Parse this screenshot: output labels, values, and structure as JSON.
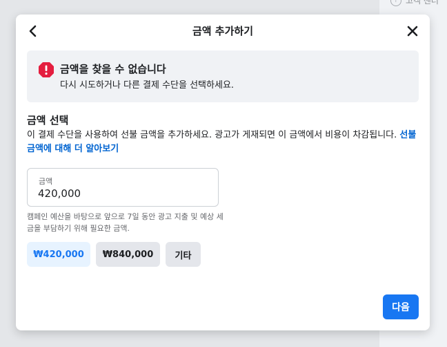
{
  "backdrop": {
    "corner_text": "고객 센터"
  },
  "dialog": {
    "title": "금액 추가하기",
    "error": {
      "title": "금액을 찾을 수 없습니다",
      "description": "다시 시도하거나 다른 결제 수단을 선택하세요."
    },
    "section": {
      "title": "금액 선택",
      "description": "이 결제 수단을 사용하여 선불 금액을 추가하세요. 광고가 게재되면 이 금액에서 비용이 차감됩니다.",
      "learn_more": "선불 금액에 대해 더 알아보기"
    },
    "amount_field": {
      "label": "금액",
      "value": "420,000"
    },
    "hint": "캠페인 예산을 바탕으로 앞으로 7일 동안 광고 지출 및 예상 세금을 부담하기 위해 필요한 금액.",
    "chips": [
      {
        "label": "₩420,000",
        "selected": true
      },
      {
        "label": "₩840,000",
        "selected": false
      },
      {
        "label": "기타",
        "selected": false
      }
    ],
    "next_label": "다음"
  },
  "colors": {
    "accent": "#1877f2",
    "error": "#e41e3f",
    "link": "#0064d1"
  }
}
